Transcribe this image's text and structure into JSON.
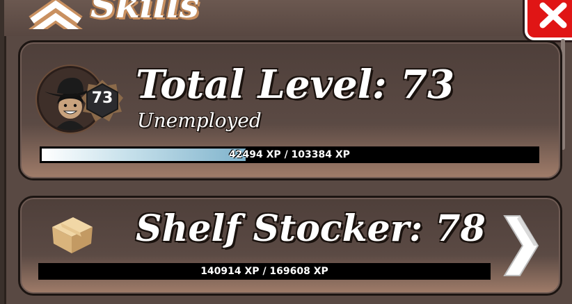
{
  "header": {
    "title": "Skills",
    "collapse_icon": "double-chevron-up-icon",
    "close_icon": "close-x-icon"
  },
  "total_card": {
    "title": "Total Level: 73",
    "subtitle": "Unemployed",
    "badge_level": "73",
    "xp_text": "42494 XP / 103384 XP",
    "xp_current": 42494,
    "xp_max": 103384,
    "progress_fraction": 0.411
  },
  "skill_card": {
    "title": "Shelf Stocker: 78",
    "icon": "cardboard-box-icon",
    "xp_text": "140914 XP / 169608 XP",
    "xp_current": 140914,
    "xp_max": 169608,
    "next_icon": "chevron-right-icon"
  },
  "colors": {
    "panel": "#594943",
    "close_red": "#e01515",
    "title_outline": "#c99060",
    "bar_fill": "#7fb3cc"
  }
}
